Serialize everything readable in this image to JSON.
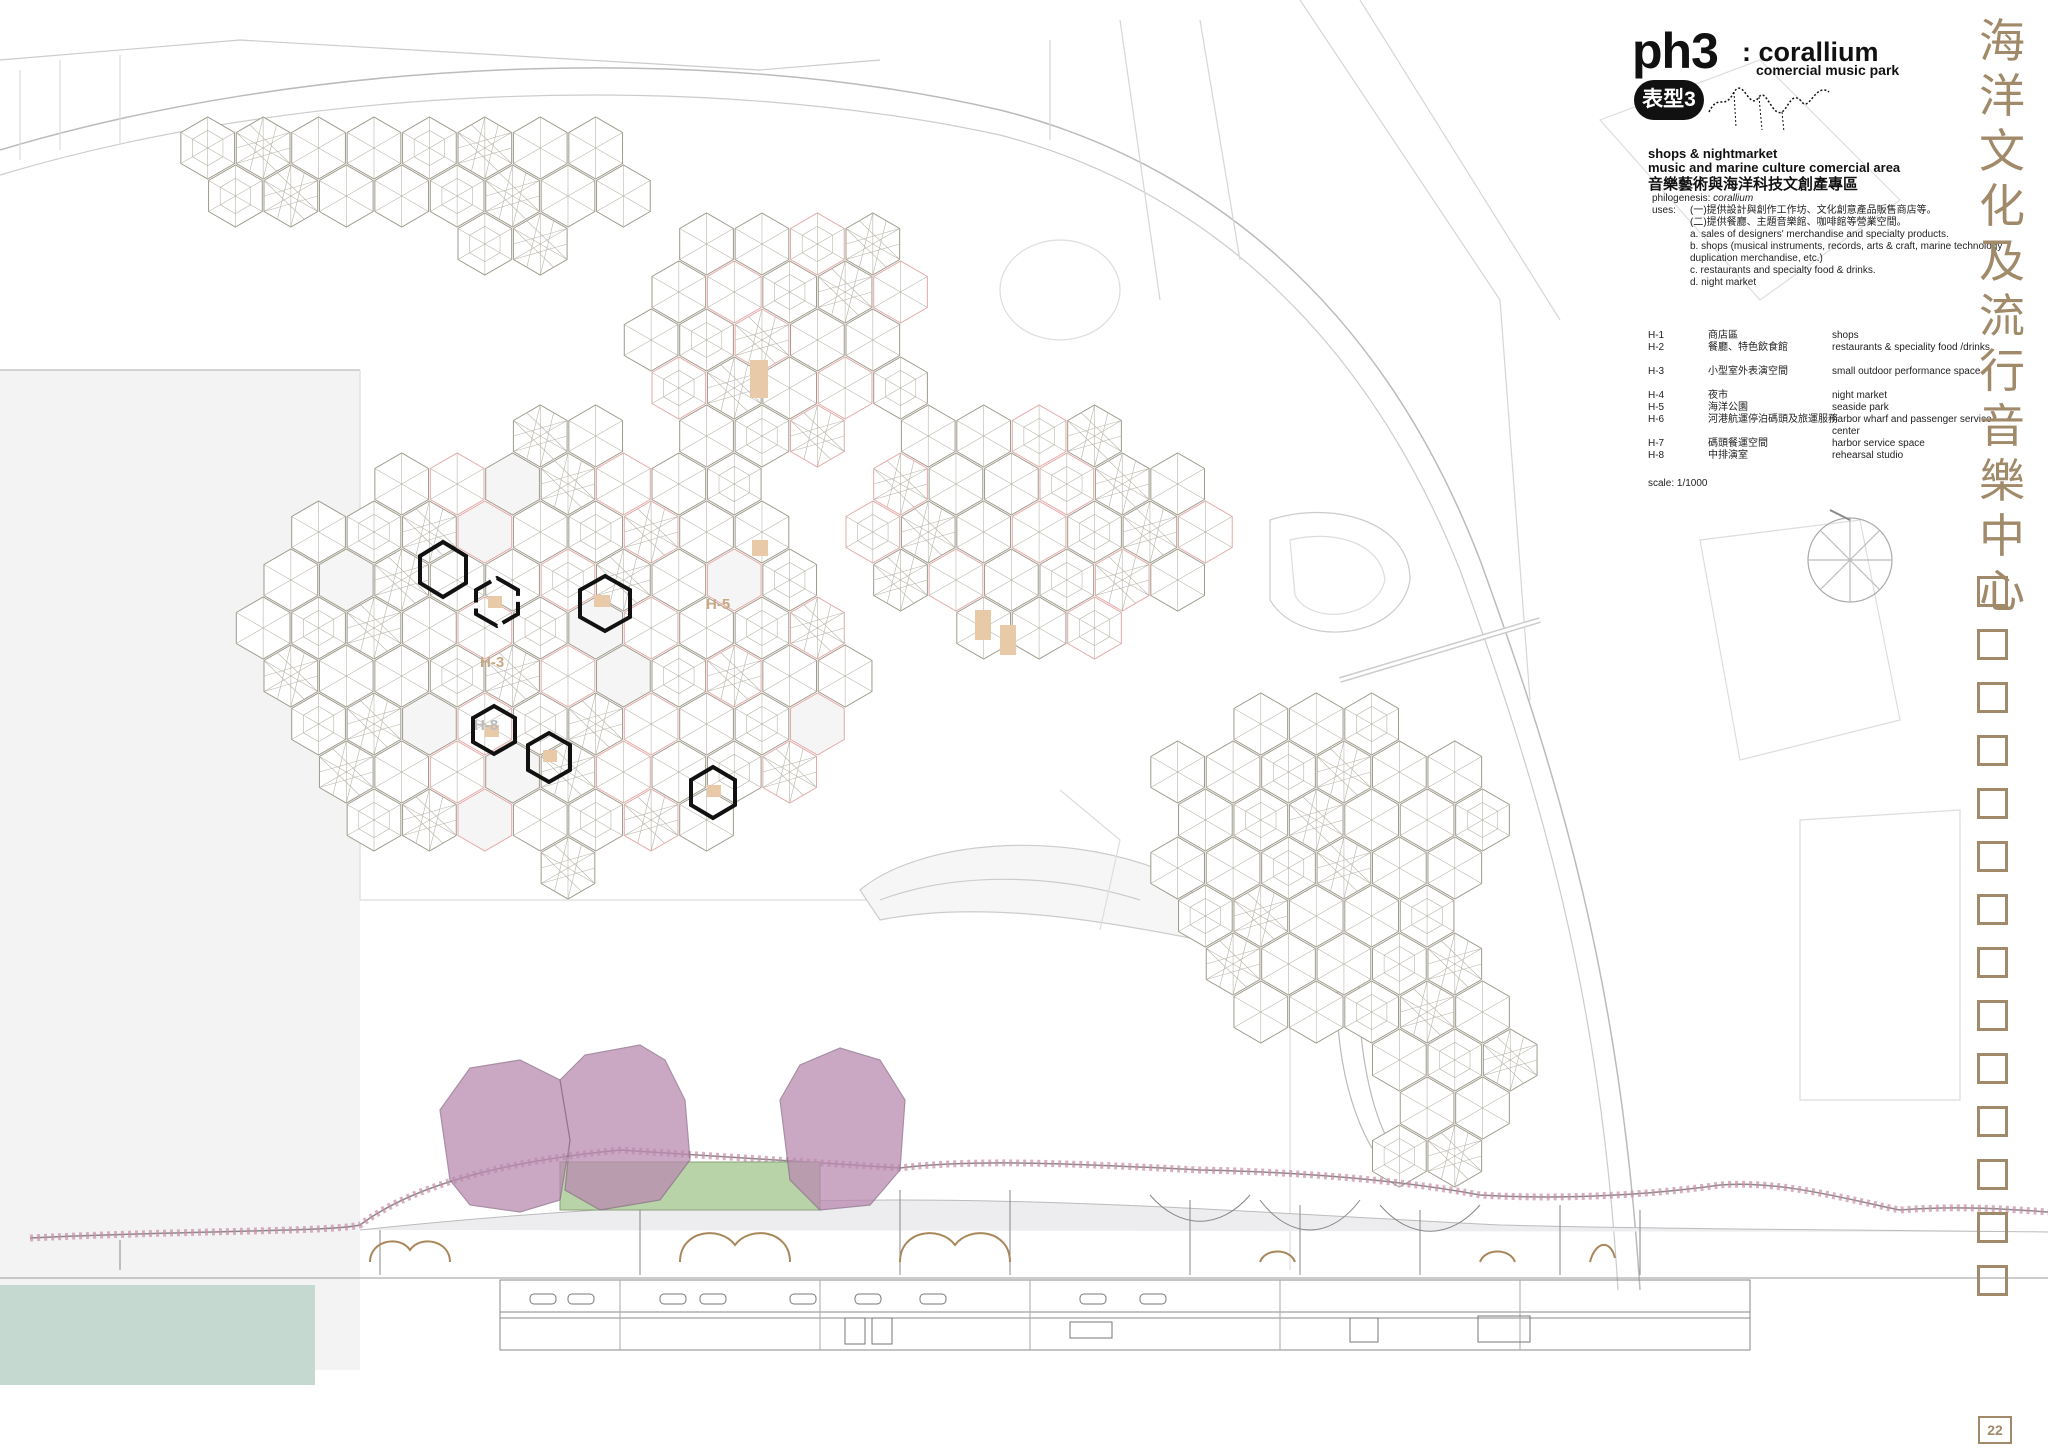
{
  "header": {
    "code": "ph3",
    "badge": "表型3",
    "name": ": corallium",
    "subtitle": "comercial music park"
  },
  "vertical_title": [
    "海",
    "洋",
    "文",
    "化",
    "及",
    "流",
    "行",
    "音",
    "樂",
    "中",
    "心"
  ],
  "description": {
    "heading_line1": "shops & nightmarket",
    "heading_line2": "music and marine culture comercial area",
    "heading_zh": "音樂藝術與海洋科技文創產專區",
    "phylogenesis_label": "philogenesis:",
    "phylogenesis_value": "corallium",
    "uses_label": "uses:",
    "uses": [
      "(一)提供設計與創作工作坊、文化創意產品販售商店等。",
      "(二)提供餐廳、主題音樂館、咖啡館等營業空間。",
      "a. sales of designers' merchandise and specialty products.",
      "b. shops (musical instruments, records, arts & craft, marine technology duplication merchandise, etc.)",
      "c. restaurants and specialty food & drinks.",
      "d. night market"
    ]
  },
  "legend": [
    {
      "code": "H-1",
      "zh": "商店區",
      "en": "shops"
    },
    {
      "code": "H-2",
      "zh": "餐廳、特色飲食館",
      "en": "restaurants & speciality food /drinks"
    },
    {
      "code": "H-3",
      "zh": "小型室外表演空間",
      "en": "small outdoor performance space"
    },
    {
      "code": "H-4",
      "zh": "夜市",
      "en": "night market"
    },
    {
      "code": "H-5",
      "zh": "海洋公園",
      "en": "seaside park"
    },
    {
      "code": "H-6",
      "zh": "河港航運停泊碼頭及旅運服務",
      "en": "harbor wharf and passenger service center"
    },
    {
      "code": "H-7",
      "zh": "碼頭餐運空間",
      "en": "harbor service space"
    },
    {
      "code": "H-8",
      "zh": "中排演室",
      "en": "rehearsal studio"
    }
  ],
  "scale": "scale: 1/1000",
  "plan_labels": {
    "h5": "H-5",
    "h3": "H-3",
    "h8": "H-8"
  },
  "page_number": "22",
  "colors": {
    "accent": "#a08a6a",
    "canopy_pink": "#b98ab0",
    "green_roof": "#b9d3a9",
    "grid_red": "#e6a9a9",
    "water_grey": "#f2f2f4",
    "sea_green": "#c6d9d0"
  }
}
